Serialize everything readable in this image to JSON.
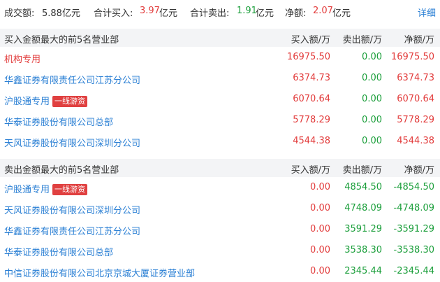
{
  "summary": {
    "turnover_label": "成交额:",
    "turnover_value": "5.88亿元",
    "buy_label": "合计买入:",
    "buy_value": "3.97",
    "buy_unit": "亿元",
    "sell_label": "合计卖出:",
    "sell_value": "1.91",
    "sell_unit": "亿元",
    "net_label": "净额:",
    "net_value": "2.07",
    "net_unit": "亿元",
    "detail_link": "详细"
  },
  "buy_section": {
    "title": "买入金额最大的前5名营业部",
    "col_buy": "买入额/万",
    "col_sell": "卖出额/万",
    "col_net": "净额/万",
    "rows": [
      {
        "name": "机构专用",
        "tag": "",
        "buy": "16975.50",
        "sell": "0.00",
        "net": "16975.50"
      },
      {
        "name": "华鑫证券有限责任公司江苏分公司",
        "tag": "",
        "buy": "6374.73",
        "sell": "0.00",
        "net": "6374.73"
      },
      {
        "name": "沪股通专用",
        "tag": "一线游资",
        "buy": "6070.64",
        "sell": "0.00",
        "net": "6070.64"
      },
      {
        "name": "华泰证券股份有限公司总部",
        "tag": "",
        "buy": "5778.29",
        "sell": "0.00",
        "net": "5778.29"
      },
      {
        "name": "天风证券股份有限公司深圳分公司",
        "tag": "",
        "buy": "4544.38",
        "sell": "0.00",
        "net": "4544.38"
      }
    ]
  },
  "sell_section": {
    "title": "卖出金额最大的前5名营业部",
    "col_buy": "买入额/万",
    "col_sell": "卖出额/万",
    "col_net": "净额/万",
    "rows": [
      {
        "name": "沪股通专用",
        "tag": "一线游资",
        "buy": "0.00",
        "sell": "4854.50",
        "net": "-4854.50"
      },
      {
        "name": "天风证券股份有限公司深圳分公司",
        "tag": "",
        "buy": "0.00",
        "sell": "4748.09",
        "net": "-4748.09"
      },
      {
        "name": "华鑫证券有限责任公司江苏分公司",
        "tag": "",
        "buy": "0.00",
        "sell": "3591.29",
        "net": "-3591.29"
      },
      {
        "name": "华泰证券股份有限公司总部",
        "tag": "",
        "buy": "0.00",
        "sell": "3538.30",
        "net": "-3538.30"
      },
      {
        "name": "中信证券股份有限公司北京京城大厦证券营业部",
        "tag": "",
        "buy": "0.00",
        "sell": "2345.44",
        "net": "-2345.44"
      }
    ]
  },
  "colors": {
    "up": "#e23b3b",
    "down": "#1a9e3a",
    "link": "#2a7fd4"
  }
}
